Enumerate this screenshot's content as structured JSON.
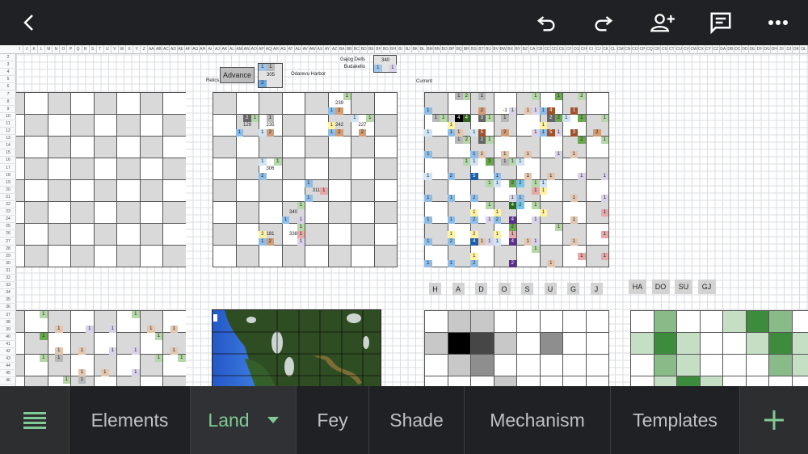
{
  "toolbar": {
    "icons": [
      "back-chevron-icon",
      "undo-icon",
      "redo-icon",
      "add-person-icon",
      "comment-icon",
      "more-icon"
    ]
  },
  "sheet": {
    "column_headers": [
      "I",
      "J",
      "K",
      "L",
      "M",
      "N",
      "O",
      "P",
      "Q",
      "R",
      "S",
      "T",
      "U",
      "V",
      "W",
      "X",
      "Y",
      "Z",
      "AA",
      "AB",
      "AC",
      "AD",
      "AE",
      "AF",
      "AG",
      "AH",
      "AI",
      "AJ",
      "AK",
      "AL",
      "AM",
      "AN",
      "AO",
      "AP",
      "AQ",
      "AR",
      "AS",
      "AT",
      "AU",
      "AV",
      "AW",
      "AX",
      "AY",
      "AZ",
      "BA",
      "BB",
      "BC",
      "BD",
      "BE",
      "BF",
      "BG",
      "BH",
      "BI",
      "BJ",
      "BK",
      "BL",
      "BM",
      "BN",
      "BO",
      "BP",
      "BQ",
      "BR",
      "BS",
      "BT",
      "BU",
      "BV",
      "BW",
      "BX",
      "BY",
      "BZ",
      "CA",
      "CB",
      "CC",
      "CD",
      "CE",
      "CF",
      "CG",
      "CH",
      "CI",
      "CJ",
      "CK",
      "CL",
      "CM",
      "CN",
      "CO",
      "CP",
      "CQ",
      "CR",
      "CS",
      "CT",
      "CU",
      "CV",
      "CW",
      "CX",
      "CY",
      "CZ",
      "DA",
      "DB",
      "DC",
      "DD",
      "DE",
      "DF",
      "DG",
      "DH",
      "DI",
      "DJ",
      "DK",
      "DL"
    ],
    "row_headers": [
      "2",
      "3",
      "4",
      "5",
      "6",
      "7",
      "8",
      "9",
      "10",
      "11",
      "12",
      "13",
      "14",
      "15",
      "16",
      "17",
      "18",
      "19",
      "20",
      "21",
      "22",
      "23",
      "24",
      "25",
      "26",
      "27",
      "28",
      "29",
      "30",
      "31",
      "32",
      "33",
      "34",
      "35",
      "36",
      "37",
      "38",
      "39",
      "40",
      "41",
      "42",
      "43",
      "44",
      "45",
      "46"
    ],
    "labels": {
      "relics": "Relics",
      "advance": "Advance",
      "harbor": "Odarevu Harbor",
      "current": "Current",
      "dells": "Gajog Dells",
      "budakello": "Budakello"
    },
    "relic_panel": {
      "top_left": "1",
      "top_right": "1",
      "value": "305",
      "bottom": "2"
    },
    "dells_panel": {
      "value": "340",
      "left": "1",
      "right": "1"
    },
    "letter_tags": [
      "H",
      "A",
      "D",
      "O",
      "S",
      "U",
      "G",
      "J"
    ],
    "pair_tags": [
      "HA",
      "DO",
      "SU",
      "GJ"
    ],
    "palette": {
      "g": "#b6d7a8",
      "G": "#6aa84f",
      "D": "#2d6a1a",
      "b": "#8fbde6",
      "l": "#d0e4f5",
      "B": "#1c5fa8",
      "c": "#76c5e8",
      "k": "#b7b7b7",
      "K": "#666666",
      "X": "#000000",
      "o": "#d19c76",
      "t": "#e3c6b0",
      "n": "#a0522d",
      "p": "#d9d2e9",
      "v": "#5b2d90",
      "y": "#fff2a6",
      "r": "#e6a8a8"
    },
    "relics_board_markers": [
      [
        0,
        17,
        "1",
        "g"
      ],
      [
        1,
        16,
        "239",
        ""
      ],
      [
        2,
        15,
        "1",
        "b"
      ],
      [
        2,
        16,
        "2",
        "o"
      ],
      [
        3,
        4,
        "2",
        "K"
      ],
      [
        3,
        5,
        "1",
        "g"
      ],
      [
        4,
        4,
        "129",
        ""
      ],
      [
        5,
        3,
        "1",
        "b"
      ],
      [
        3,
        7,
        "1",
        "k"
      ],
      [
        4,
        7,
        "235",
        ""
      ],
      [
        5,
        6,
        "1",
        "l"
      ],
      [
        5,
        7,
        "2",
        "o"
      ],
      [
        4,
        15,
        "1",
        "y"
      ],
      [
        4,
        16,
        "242",
        ""
      ],
      [
        5,
        15,
        "1",
        "b"
      ],
      [
        5,
        16,
        "2",
        "o"
      ],
      [
        3,
        18,
        "1",
        "l"
      ],
      [
        3,
        20,
        "1",
        "g"
      ],
      [
        4,
        19,
        "227",
        ""
      ],
      [
        5,
        19,
        "2",
        "o"
      ],
      [
        9,
        6,
        "1",
        "l"
      ],
      [
        9,
        8,
        "1",
        "g"
      ],
      [
        10,
        7,
        "306",
        ""
      ],
      [
        11,
        6,
        "2",
        "b"
      ],
      [
        12,
        12,
        "1",
        "b"
      ],
      [
        13,
        13,
        "311",
        ""
      ],
      [
        13,
        14,
        "1",
        "r"
      ],
      [
        14,
        12,
        "1",
        "b"
      ],
      [
        15,
        11,
        "1",
        "g"
      ],
      [
        16,
        10,
        "340",
        ""
      ],
      [
        17,
        9,
        "1",
        "b"
      ],
      [
        17,
        11,
        "1",
        "p"
      ],
      [
        18,
        11,
        "1",
        "g"
      ],
      [
        19,
        6,
        "2",
        "y"
      ],
      [
        19,
        7,
        "181",
        ""
      ],
      [
        19,
        10,
        "338",
        ""
      ],
      [
        19,
        11,
        "1",
        "r"
      ],
      [
        20,
        6,
        "1",
        "b"
      ],
      [
        20,
        7,
        "2",
        "o"
      ],
      [
        20,
        11,
        "1",
        "p"
      ]
    ],
    "current_board_markers": [
      [
        0,
        4,
        "1",
        "k"
      ],
      [
        0,
        5,
        "2",
        "g"
      ],
      [
        0,
        7,
        "1",
        "k"
      ],
      [
        0,
        14,
        "1",
        "g"
      ],
      [
        0,
        17,
        "1",
        "G"
      ],
      [
        0,
        20,
        "2",
        "g"
      ],
      [
        2,
        0,
        "1",
        "b"
      ],
      [
        2,
        7,
        "2",
        "o"
      ],
      [
        2,
        10,
        "-1",
        ""
      ],
      [
        2,
        11,
        "1",
        "p"
      ],
      [
        2,
        13,
        "1",
        "t"
      ],
      [
        2,
        14,
        "1",
        "p"
      ],
      [
        2,
        15,
        "1",
        "b"
      ],
      [
        2,
        16,
        "4",
        "n"
      ],
      [
        2,
        19,
        "1",
        "n"
      ],
      [
        3,
        1,
        "1",
        "k"
      ],
      [
        3,
        2,
        "1",
        "g"
      ],
      [
        3,
        4,
        "4",
        "X"
      ],
      [
        3,
        5,
        "4",
        "D"
      ],
      [
        3,
        7,
        "3",
        "K"
      ],
      [
        3,
        8,
        "1",
        "g"
      ],
      [
        3,
        10,
        "1",
        "k"
      ],
      [
        3,
        16,
        "2",
        "K"
      ],
      [
        3,
        17,
        "2",
        "G"
      ],
      [
        3,
        18,
        "1",
        "l"
      ],
      [
        3,
        20,
        "1",
        "G"
      ],
      [
        3,
        23,
        "1",
        "g"
      ],
      [
        4,
        3,
        "1",
        "y"
      ],
      [
        4,
        15,
        "1",
        "y"
      ],
      [
        5,
        0,
        "1",
        "l"
      ],
      [
        5,
        3,
        "1",
        "b"
      ],
      [
        5,
        4,
        "1",
        "t"
      ],
      [
        5,
        6,
        "1",
        "l"
      ],
      [
        5,
        7,
        "5",
        "n"
      ],
      [
        5,
        10,
        "2",
        "o"
      ],
      [
        5,
        14,
        "1",
        "p"
      ],
      [
        5,
        15,
        "1",
        "b"
      ],
      [
        5,
        16,
        "5",
        "n"
      ],
      [
        5,
        17,
        "1",
        "p"
      ],
      [
        5,
        19,
        "3",
        "n"
      ],
      [
        5,
        22,
        "2",
        "o"
      ],
      [
        6,
        4,
        "1",
        "k"
      ],
      [
        6,
        5,
        "2",
        "g"
      ],
      [
        6,
        7,
        "2",
        "K"
      ],
      [
        6,
        8,
        "1",
        "g"
      ],
      [
        6,
        20,
        "2",
        "G"
      ],
      [
        6,
        23,
        "1",
        "g"
      ],
      [
        8,
        0,
        "1",
        "b"
      ],
      [
        8,
        6,
        "1",
        "b"
      ],
      [
        8,
        7,
        "1",
        "t"
      ],
      [
        8,
        10,
        "1",
        "t"
      ],
      [
        8,
        13,
        "1",
        "t"
      ],
      [
        8,
        17,
        "1",
        "p"
      ],
      [
        8,
        19,
        "1",
        "t"
      ],
      [
        9,
        5,
        "1",
        "g"
      ],
      [
        9,
        6,
        "1",
        "l"
      ],
      [
        9,
        8,
        "3",
        "G"
      ],
      [
        9,
        10,
        "1",
        "k"
      ],
      [
        9,
        11,
        "1",
        "g"
      ],
      [
        9,
        12,
        "1",
        "l"
      ],
      [
        11,
        0,
        "1",
        "l"
      ],
      [
        11,
        3,
        "2",
        "b"
      ],
      [
        11,
        6,
        "5",
        "B"
      ],
      [
        11,
        9,
        "1",
        "b"
      ],
      [
        11,
        13,
        "1",
        "t"
      ],
      [
        11,
        16,
        "1",
        "t"
      ],
      [
        11,
        20,
        "1",
        "p"
      ],
      [
        11,
        23,
        "1",
        "p"
      ],
      [
        12,
        8,
        "1",
        "g"
      ],
      [
        12,
        9,
        "1",
        "l"
      ],
      [
        12,
        11,
        "2",
        "G"
      ],
      [
        12,
        12,
        "2",
        "c"
      ],
      [
        12,
        14,
        "1",
        "g"
      ],
      [
        12,
        15,
        "1",
        "l"
      ],
      [
        13,
        14,
        "1",
        "r"
      ],
      [
        13,
        15,
        "1",
        "y"
      ],
      [
        14,
        0,
        "1",
        "b"
      ],
      [
        14,
        3,
        "1",
        "b"
      ],
      [
        14,
        6,
        "2",
        "b"
      ],
      [
        14,
        11,
        "1",
        "p"
      ],
      [
        14,
        12,
        "1",
        "b"
      ],
      [
        14,
        19,
        "1",
        "t"
      ],
      [
        14,
        23,
        "1",
        "p"
      ],
      [
        15,
        8,
        "1",
        "g"
      ],
      [
        15,
        11,
        "4",
        "D"
      ],
      [
        15,
        12,
        "2",
        "c"
      ],
      [
        15,
        14,
        "1",
        "g"
      ],
      [
        16,
        6,
        "1",
        "y"
      ],
      [
        16,
        9,
        "1",
        "y"
      ],
      [
        16,
        15,
        "1",
        "y"
      ],
      [
        16,
        23,
        "1",
        "r"
      ],
      [
        17,
        0,
        "1",
        "b"
      ],
      [
        17,
        3,
        "1",
        "b"
      ],
      [
        17,
        6,
        "2",
        "b"
      ],
      [
        17,
        8,
        "1",
        "p"
      ],
      [
        17,
        9,
        "2",
        "b"
      ],
      [
        17,
        11,
        "4",
        "v"
      ],
      [
        17,
        14,
        "1",
        "p"
      ],
      [
        17,
        19,
        "1",
        "t"
      ],
      [
        18,
        11,
        "2",
        "G"
      ],
      [
        18,
        17,
        "1",
        "g"
      ],
      [
        19,
        3,
        "1",
        "y"
      ],
      [
        19,
        6,
        "2",
        "y"
      ],
      [
        19,
        9,
        "1",
        "y"
      ],
      [
        19,
        11,
        "1",
        "r"
      ],
      [
        19,
        23,
        "1",
        "r"
      ],
      [
        20,
        0,
        "1",
        "b"
      ],
      [
        20,
        3,
        "2",
        "b"
      ],
      [
        20,
        6,
        "4",
        "B"
      ],
      [
        20,
        7,
        "1",
        "t"
      ],
      [
        20,
        8,
        "1",
        "p"
      ],
      [
        20,
        9,
        "1",
        "l"
      ],
      [
        20,
        11,
        "4",
        "v"
      ],
      [
        20,
        13,
        "1",
        "t"
      ],
      [
        20,
        14,
        "1",
        "p"
      ],
      [
        20,
        19,
        "1",
        "t"
      ],
      [
        21,
        14,
        "1",
        "g"
      ],
      [
        22,
        6,
        "1",
        "y"
      ],
      [
        22,
        20,
        "1",
        "r"
      ],
      [
        22,
        23,
        "1",
        "r"
      ],
      [
        23,
        0,
        "1",
        "b"
      ],
      [
        23,
        3,
        "1",
        "b"
      ],
      [
        23,
        6,
        "2",
        "b"
      ],
      [
        23,
        11,
        "2",
        "v"
      ],
      [
        23,
        16,
        "1",
        "t"
      ]
    ],
    "lower_board_markers": [
      [
        0,
        2,
        "1",
        "g"
      ],
      [
        0,
        14,
        "1",
        "g"
      ],
      [
        2,
        4,
        "1",
        "t"
      ],
      [
        2,
        8,
        "1",
        "p"
      ],
      [
        2,
        11,
        "1",
        "p"
      ],
      [
        2,
        16,
        "1",
        "t"
      ],
      [
        2,
        19,
        "1",
        "t"
      ],
      [
        3,
        2,
        "1",
        "G"
      ],
      [
        3,
        17,
        "1",
        "g"
      ],
      [
        5,
        4,
        "1",
        "t"
      ],
      [
        5,
        7,
        "1",
        "t"
      ],
      [
        5,
        11,
        "1",
        "p"
      ],
      [
        5,
        14,
        "1",
        "p"
      ],
      [
        5,
        19,
        "1",
        "t"
      ],
      [
        6,
        2,
        "1",
        "g"
      ],
      [
        6,
        4,
        "1",
        "k"
      ],
      [
        6,
        17,
        "1",
        "g"
      ],
      [
        6,
        20,
        "1",
        "g"
      ],
      [
        8,
        7,
        "1",
        "t"
      ],
      [
        8,
        10,
        "1",
        "t"
      ],
      [
        8,
        14,
        "1",
        "p"
      ],
      [
        9,
        5,
        "1",
        "g"
      ],
      [
        9,
        7,
        "1",
        "k"
      ]
    ],
    "letter_heat_levels": [
      [
        0,
        0.3,
        0.3,
        0,
        0,
        0,
        0,
        0
      ],
      [
        0.3,
        1,
        0.75,
        0.3,
        0,
        0.5,
        0,
        0
      ],
      [
        0,
        0.3,
        0.5,
        0,
        0,
        0,
        0,
        0
      ],
      [
        0,
        0,
        0,
        0.3,
        0,
        0,
        0,
        0
      ]
    ],
    "pair_heat_levels": [
      [
        0,
        2,
        0,
        0,
        1,
        3,
        2,
        0
      ],
      [
        1,
        3,
        1,
        0,
        0,
        1,
        3,
        1
      ],
      [
        0,
        2,
        1,
        0,
        0,
        0,
        2,
        1
      ],
      [
        0,
        1,
        3,
        1,
        0,
        0,
        0,
        0
      ]
    ]
  },
  "tabs": {
    "menu_icon": "menu-icon",
    "items": [
      {
        "label": "Elements",
        "active": false
      },
      {
        "label": "Land",
        "active": true
      },
      {
        "label": "Fey",
        "active": false
      },
      {
        "label": "Shade",
        "active": false
      },
      {
        "label": "Mechanism",
        "active": false
      },
      {
        "label": "Templates",
        "active": false
      }
    ],
    "add_icon": "add-sheet-icon",
    "accent": "#81c995"
  }
}
